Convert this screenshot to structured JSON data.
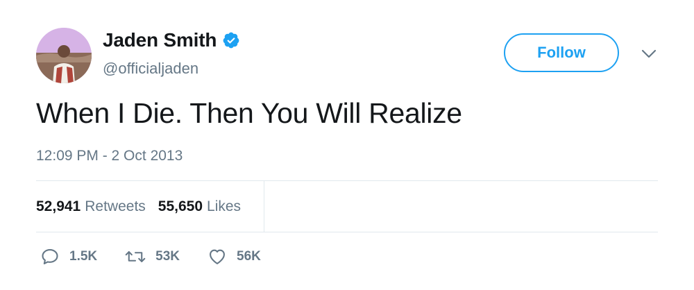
{
  "user": {
    "name": "Jaden Smith",
    "handle": "@officialjaden",
    "verified": true
  },
  "follow_button": {
    "label": "Follow"
  },
  "tweet": {
    "text": "When I Die. Then You Will Realize",
    "timestamp": "12:09 PM - 2 Oct 2013"
  },
  "stats": {
    "retweets_count": "52,941",
    "retweets_label": "Retweets",
    "likes_count": "55,650",
    "likes_label": "Likes"
  },
  "actions": {
    "reply_count": "1.5K",
    "retweet_count": "53K",
    "like_count": "56K"
  },
  "icons": {
    "verified": "verified-badge-icon",
    "caret": "chevron-down-icon",
    "reply": "reply-icon",
    "retweet": "retweet-icon",
    "like": "heart-icon"
  },
  "colors": {
    "accent": "#1da1f2",
    "text_primary": "#14171a",
    "text_secondary": "#657786",
    "divider": "#e1e8ed"
  }
}
